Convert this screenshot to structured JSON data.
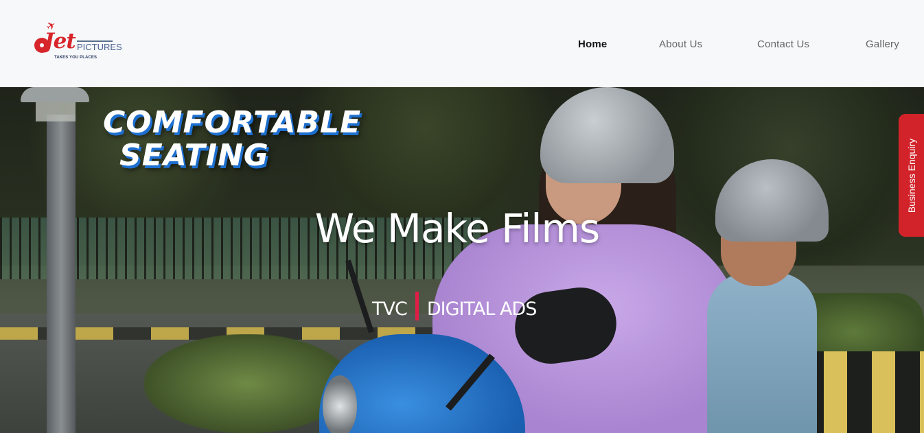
{
  "logo": {
    "brand_primary": "Jet",
    "brand_secondary": "PICTURES",
    "tagline": "TAKES YOU PLACES",
    "brand_color": "#d7262b"
  },
  "nav": {
    "items": [
      {
        "label": "Home",
        "active": true
      },
      {
        "label": "About Us",
        "active": false
      },
      {
        "label": "Contact Us",
        "active": false
      },
      {
        "label": "Gallery",
        "active": false
      }
    ]
  },
  "hero": {
    "overlay_text_line1": "COMFORTABLE",
    "overlay_text_line2": "SEATING",
    "title": "We Make Films",
    "subtitle_left": "TVC",
    "subtitle_right": "DIGITAL ADS",
    "separator_color": "#e01e45"
  },
  "side_tab": {
    "label": "Business Enquiry",
    "color": "#d2232a"
  }
}
